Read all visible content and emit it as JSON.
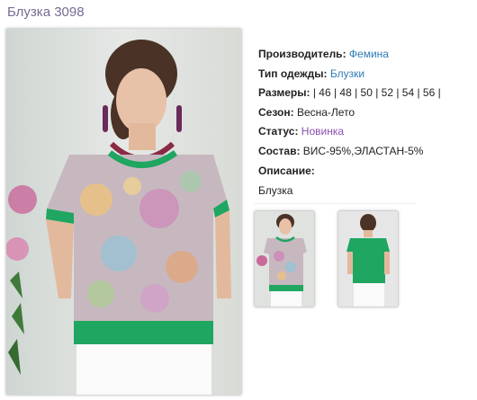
{
  "product": {
    "title": "Блузка 3098"
  },
  "properties": {
    "manufacturer": {
      "label": "Производитель:",
      "value": "Фемина"
    },
    "clothing_type": {
      "label": "Тип одежды:",
      "value": "Блузки"
    },
    "sizes": {
      "label": "Размеры:",
      "value": "| 46 | 48 | 50 | 52 | 54 | 56 |"
    },
    "season": {
      "label": "Сезон:",
      "value": "Весна-Лето"
    },
    "status": {
      "label": "Статус:",
      "value": "Новинка"
    },
    "composition": {
      "label": "Состав:",
      "value": "ВИС-95%,ЭЛАСТАН-5%"
    },
    "description": {
      "label": "Описание:",
      "value": "Блузка"
    }
  },
  "colors": {
    "title": "#7a6a95",
    "link": "#2e7cb5",
    "status_link": "#8a4fb0",
    "garment_trim": "#1fa660"
  }
}
